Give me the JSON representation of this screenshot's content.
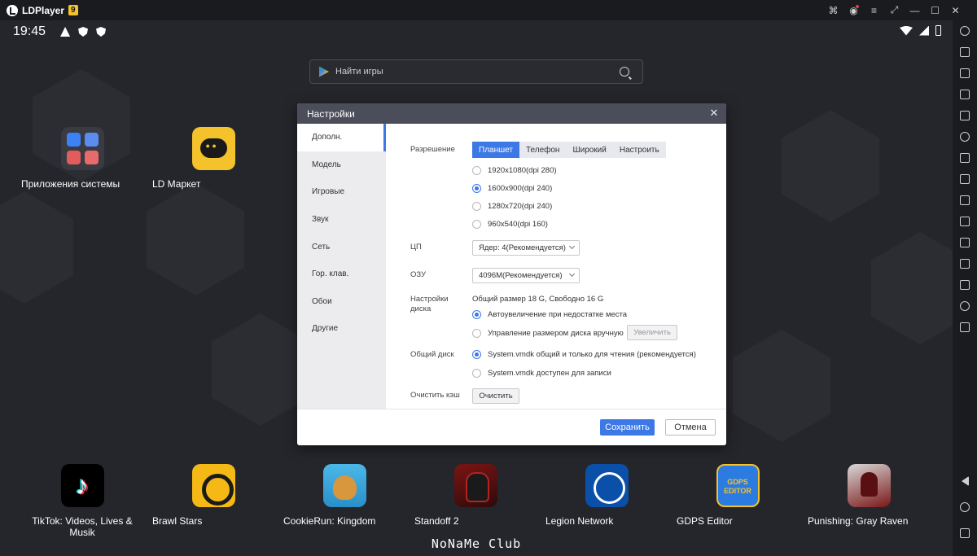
{
  "titlebar": {
    "app_name": "LDPlayer",
    "version_badge": "9",
    "icons": [
      "gamepad-icon",
      "account-icon",
      "menu-icon",
      "expand-icon",
      "minimize-icon",
      "maximize-icon",
      "close-icon"
    ]
  },
  "statusbar": {
    "time": "19:45"
  },
  "search": {
    "placeholder": "Найти игры"
  },
  "desktop": {
    "top_apps": [
      {
        "label": "Приложения системы"
      },
      {
        "label": "LD Маркет"
      }
    ],
    "dock_apps": [
      {
        "label": "TikTok: Videos, Lives & Musik"
      },
      {
        "label": "Brawl Stars"
      },
      {
        "label": "CookieRun: Kingdom"
      },
      {
        "label": "Standoff 2"
      },
      {
        "label": "Legion Network"
      },
      {
        "label": "GDPS Editor"
      },
      {
        "label": "Punishing: Gray Raven"
      }
    ],
    "watermark": "NoNaMe Club"
  },
  "settings": {
    "title": "Настройки",
    "nav": [
      {
        "label": "Дополн."
      },
      {
        "label": "Модель"
      },
      {
        "label": "Игровые"
      },
      {
        "label": "Звук"
      },
      {
        "label": "Сеть"
      },
      {
        "label": "Гор. клав."
      },
      {
        "label": "Обои"
      },
      {
        "label": "Другие"
      }
    ],
    "resolution": {
      "label": "Разрешение",
      "tabs": [
        "Планшет",
        "Телефон",
        "Широкий",
        "Настроить"
      ],
      "active_tab": "Планшет",
      "options": [
        "1920x1080(dpi 280)",
        "1600x900(dpi 240)",
        "1280x720(dpi 240)",
        "960x540(dpi 160)"
      ],
      "selected": "1600x900(dpi 240)"
    },
    "cpu": {
      "label": "ЦП",
      "value": "Ядер: 4(Рекомендуется)"
    },
    "ram": {
      "label": "ОЗУ",
      "value": "4096М(Рекомендуется)"
    },
    "disk": {
      "label": "Настройки диска",
      "info": "Общий размер 18 G, Свободно 16 G",
      "options": [
        "Автоувеличение при недостатке места",
        "Управление размером диска вручную"
      ],
      "selected": "Автоувеличение при недостатке места",
      "expand_button": "Увеличить"
    },
    "shared_disk": {
      "label": "Общий диск",
      "options": [
        "System.vmdk общий и только для чтения (рекомендуется)",
        "System.vmdk доступен для записи"
      ],
      "selected": "System.vmdk общий и только для чтения (рекомендуется)"
    },
    "cache": {
      "label": "Очистить кэш",
      "button": "Очистить"
    },
    "save_button": "Сохранить",
    "cancel_button": "Отмена"
  }
}
